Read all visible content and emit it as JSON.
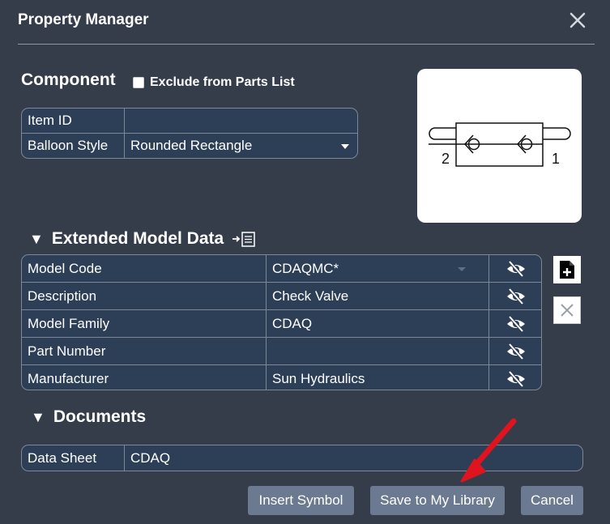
{
  "dialog": {
    "title": "Property Manager"
  },
  "component": {
    "heading": "Component",
    "exclude_label": "Exclude from Parts List",
    "exclude_checked": false,
    "rows": [
      {
        "label": "Item ID",
        "value": ""
      },
      {
        "label": "Balloon Style",
        "value": "Rounded Rectangle"
      }
    ]
  },
  "symbol": {
    "port_left": "2",
    "port_right": "1"
  },
  "extended": {
    "heading": "Extended Model Data",
    "rows": [
      {
        "label": "Model Code",
        "value": "CDAQMC*"
      },
      {
        "label": "Description",
        "value": "Check Valve"
      },
      {
        "label": "Model Family",
        "value": "CDAQ"
      },
      {
        "label": "Part Number",
        "value": ""
      },
      {
        "label": "Manufacturer",
        "value": "Sun Hydraulics"
      }
    ]
  },
  "documents": {
    "heading": "Documents",
    "rows": [
      {
        "label": "Data Sheet",
        "value": "CDAQ"
      }
    ]
  },
  "buttons": {
    "insert": "Insert Symbol",
    "save": "Save to My Library",
    "cancel": "Cancel"
  },
  "colors": {
    "dialog_bg": "#353d4a",
    "table_bg": "#2d3e57",
    "button_bg": "#6b7a90",
    "arrow": "#e0141e"
  }
}
